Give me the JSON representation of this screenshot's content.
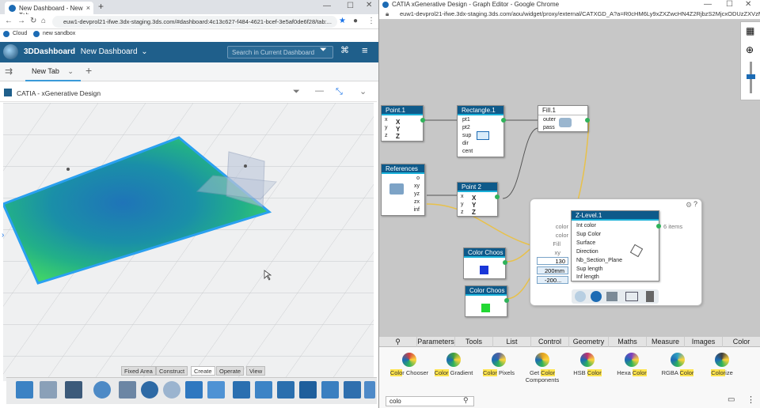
{
  "left_browser": {
    "tab_title": "New Dashboard - New Tab",
    "url": "euw1-devprol21-ifwe.3dx-staging.3ds.com/#dashboard:4c13c627-f484-4621-bcef-3e5af0de6f28/tab:...",
    "bookmarks": [
      "Cloud",
      "new sandbox"
    ]
  },
  "dashboard": {
    "brand": "3DDashboard",
    "name": "New Dashboard",
    "search_placeholder": "Search in Current Dashboard",
    "tab_label": "New Tab",
    "app_title": "CATIA - xGenerative Design"
  },
  "command_tabs": [
    "Fixed Area",
    "Construct",
    "Create",
    "Operate",
    "View"
  ],
  "right_browser": {
    "title": "CATIA xGenerative Design - Graph Editor - Google Chrome",
    "url": "euw1-devprol21-ifwe.3dx-staging.3ds.com/aou/widget/proxy/external/CATXGD_A?a=R0cHM6Ly9xZXZwcHN4Z2RjbzS2MjcxODUzZXVzM3lsY2..."
  },
  "nodes": {
    "point1": {
      "title": "Point.1",
      "inputs": [
        "x",
        "y",
        "z"
      ]
    },
    "rectangle1": {
      "title": "Rectangle.1",
      "inputs": [
        "pt1",
        "pt2",
        "sup",
        "dir",
        "cent"
      ]
    },
    "fill1": {
      "title": "Fill.1",
      "inputs": [
        "outer",
        "pass"
      ]
    },
    "references": {
      "title": "References",
      "outputs": [
        "o",
        "xy",
        "yz",
        "zx",
        "inf"
      ]
    },
    "point2": {
      "title": "Point 2",
      "inputs": [
        "x",
        "y",
        "z"
      ]
    },
    "color1": {
      "title": "Color Choos"
    },
    "color2": {
      "title": "Color Choos"
    },
    "zlevel": {
      "title": "Z-Level.1",
      "inputs": [
        "Int color",
        "Sup Color",
        "Surface",
        "Direction",
        "Nb_Section_Plane",
        "Sup length",
        "Inf length"
      ],
      "ext_labels": [
        "color",
        "color",
        "Fill",
        "xy"
      ],
      "values": [
        "130",
        "200mm",
        "-200..."
      ],
      "output_label": "6 items"
    }
  },
  "panel_tabs": [
    "Parameters",
    "Tools",
    "List",
    "Control",
    "Geometry",
    "Maths",
    "Measure",
    "Images",
    "Color"
  ],
  "tools": [
    {
      "label_hl": "Colo",
      "label_rest": "r Chooser",
      "icon_color": "#d04040"
    },
    {
      "label_hl": "Color",
      "label_rest": " Gradient",
      "icon_color": "#40a040"
    },
    {
      "label_hl": "Color",
      "label_rest": " Pixels",
      "icon_color": "#5060a0"
    },
    {
      "label_hl": "Color",
      "label_rest": " Components",
      "label_pre": "Get ",
      "icon_color": "#e0a020"
    },
    {
      "label_hl": "Color",
      "label_rest": "",
      "label_pre": "HSB ",
      "icon_color": "#c03070"
    },
    {
      "label_hl": "Color",
      "label_rest": "",
      "label_pre": "Hexa ",
      "icon_color": "#8040c0"
    },
    {
      "label_hl": "Color",
      "label_rest": "",
      "label_pre": "RGBA ",
      "icon_color": "#30a0c0"
    },
    {
      "label_hl": "Color",
      "label_rest": "ize",
      "icon_color": "#404040"
    }
  ],
  "search_value": "colo"
}
